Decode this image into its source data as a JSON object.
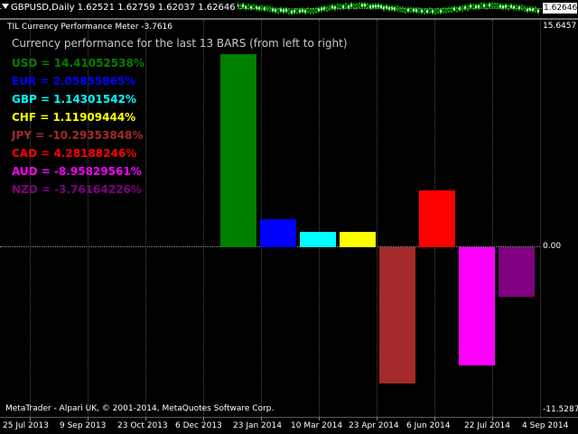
{
  "price_chart": {
    "title": "GBPUSD,Daily  1.62521 1.62759 1.62037 1.62646",
    "current_price": "1.62646"
  },
  "axis": {
    "max_label": "15.6457",
    "zero_label": "0.00",
    "min_label": "-11.5287"
  },
  "indicator": {
    "name": "TIL Currency Performance Meter -3.7616",
    "heading": "Currency performance for the last 13 BARS (from left to right)",
    "currencies": [
      {
        "label": "USD = 14.41052538%",
        "code": "USD",
        "value": 14.41052538,
        "color": "#008000"
      },
      {
        "label": "EUR = 2.05855865%",
        "code": "EUR",
        "value": 2.05855865,
        "color": "#0000ff"
      },
      {
        "label": "GBP = 1.14301542%",
        "code": "GBP",
        "value": 1.14301542,
        "color": "#00ffff"
      },
      {
        "label": "CHF = 1.11909444%",
        "code": "CHF",
        "value": 1.11909444,
        "color": "#ffff00"
      },
      {
        "label": "JPY = -10.29353848%",
        "code": "JPY",
        "value": -10.29353848,
        "color": "#a52a2a"
      },
      {
        "label": "CAD = 4.28188246%",
        "code": "CAD",
        "value": 4.28188246,
        "color": "#ff0000"
      },
      {
        "label": "AUD = -8.95829561%",
        "code": "AUD",
        "value": -8.95829561,
        "color": "#ff00ff"
      },
      {
        "label": "NZD = -3.76164226%",
        "code": "NZD",
        "value": -3.76164226,
        "color": "#800080"
      }
    ],
    "scale": {
      "max": 15.6457,
      "min": -11.5287
    }
  },
  "copyright": "MetaTrader - Alpari UK, © 2001-2014, MetaQuotes Software Corp.",
  "date_axis": {
    "labels": [
      "25 Jul 2013",
      "9 Sep 2013",
      "23 Oct 2013",
      "6 Dec 2013",
      "23 Jan 2014",
      "10 Mar 2014",
      "23 Apr 2014",
      "6 Jun 2014",
      "22 Jul 2014",
      "4 Sep 2014"
    ]
  },
  "colors": {
    "background": "#000000",
    "text": "#ffffff",
    "grid": "#4a4a4a"
  }
}
